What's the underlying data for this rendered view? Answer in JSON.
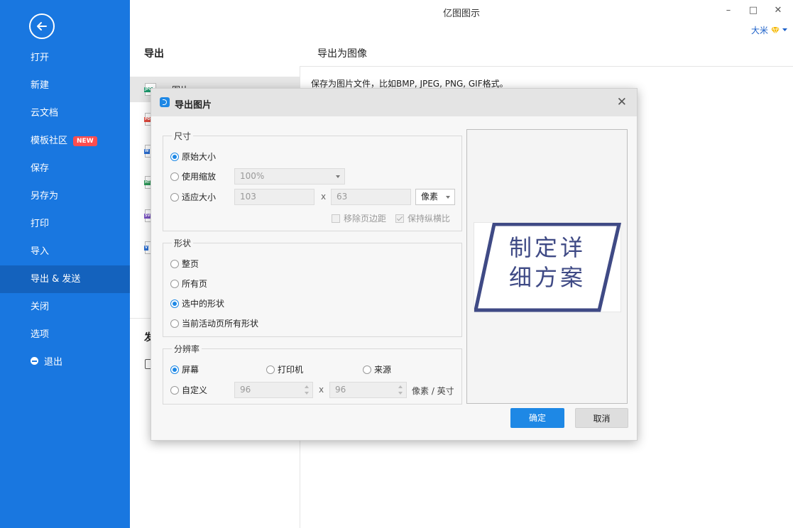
{
  "window": {
    "title": "亿图图示",
    "user": "大米"
  },
  "sidebar": {
    "items": [
      {
        "label": "打开"
      },
      {
        "label": "新建"
      },
      {
        "label": "云文档"
      },
      {
        "label": "模板社区",
        "badge": "NEW"
      },
      {
        "label": "保存"
      },
      {
        "label": "另存为"
      },
      {
        "label": "打印"
      },
      {
        "label": "导入"
      },
      {
        "label": "导出 & 发送",
        "active": true
      },
      {
        "label": "关闭"
      },
      {
        "label": "选项"
      },
      {
        "label": "退出"
      }
    ]
  },
  "middle": {
    "title": "导出",
    "selected_item_label": "图片",
    "formats": [
      "JPG",
      "PDF",
      "W",
      "HTML",
      "SVG",
      "V"
    ],
    "second_section_label": "发"
  },
  "right": {
    "title": "导出为图像",
    "description": "保存为图片文件，比如BMP, JPEG, PNG, GIF格式。"
  },
  "dialog": {
    "title": "导出图片",
    "size": {
      "legend": "尺寸",
      "original": "原始大小",
      "scale": "使用缩放",
      "scale_value": "100%",
      "fit": "适应大小",
      "width": "103",
      "height": "63",
      "x": "x",
      "unit": "像素",
      "remove_margin": "移除页边距",
      "keep_ratio": "保持纵横比"
    },
    "shape": {
      "legend": "形状",
      "whole_page": "整页",
      "all_pages": "所有页",
      "selected": "选中的形状",
      "current_page_all": "当前活动页所有形状"
    },
    "resolution": {
      "legend": "分辨率",
      "screen": "屏幕",
      "printer": "打印机",
      "source": "来源",
      "custom": "自定义",
      "dpi_x": "96",
      "dpi_y": "96",
      "x": "x",
      "unit": "像素 / 英寸"
    },
    "preview": {
      "line1": "制定详",
      "line2": "细方案"
    },
    "ok": "确定",
    "cancel": "取消"
  },
  "colors": {
    "sidebar": "#1977e0",
    "sidebar_active": "#1462bd",
    "accent": "#1e88e5",
    "preview_stroke": "#3f4a85"
  }
}
